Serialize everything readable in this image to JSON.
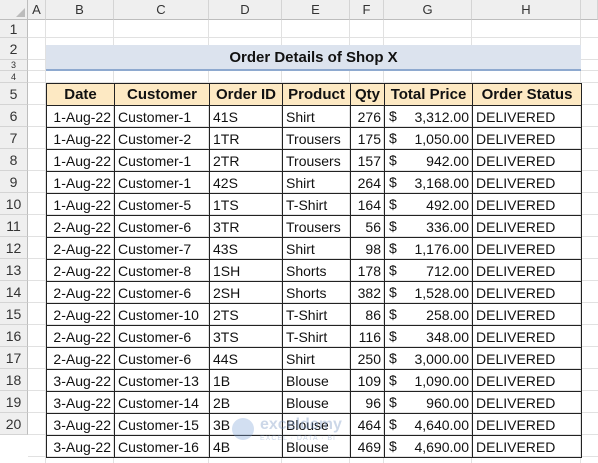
{
  "columns": [
    "A",
    "B",
    "C",
    "D",
    "E",
    "F",
    "G",
    "H"
  ],
  "rows": [
    "1",
    "2",
    "3",
    "4",
    "5",
    "6",
    "7",
    "8",
    "9",
    "10",
    "11",
    "12",
    "13",
    "14",
    "15",
    "16",
    "17",
    "18",
    "19",
    "20"
  ],
  "title": "Order Details of Shop X",
  "headers": [
    "Date",
    "Customer",
    "Order ID",
    "Product",
    "Qty",
    "Total Price",
    "Order Status"
  ],
  "currency_symbol": "$",
  "records": [
    [
      "1-Aug-22",
      "Customer-1",
      "41S",
      "Shirt",
      "276",
      "3,312.00",
      "DELIVERED"
    ],
    [
      "1-Aug-22",
      "Customer-2",
      "1TR",
      "Trousers",
      "175",
      "1,050.00",
      "DELIVERED"
    ],
    [
      "1-Aug-22",
      "Customer-1",
      "2TR",
      "Trousers",
      "157",
      "942.00",
      "DELIVERED"
    ],
    [
      "1-Aug-22",
      "Customer-1",
      "42S",
      "Shirt",
      "264",
      "3,168.00",
      "DELIVERED"
    ],
    [
      "1-Aug-22",
      "Customer-5",
      "1TS",
      "T-Shirt",
      "164",
      "492.00",
      "DELIVERED"
    ],
    [
      "2-Aug-22",
      "Customer-6",
      "3TR",
      "Trousers",
      "56",
      "336.00",
      "DELIVERED"
    ],
    [
      "2-Aug-22",
      "Customer-7",
      "43S",
      "Shirt",
      "98",
      "1,176.00",
      "DELIVERED"
    ],
    [
      "2-Aug-22",
      "Customer-8",
      "1SH",
      "Shorts",
      "178",
      "712.00",
      "DELIVERED"
    ],
    [
      "2-Aug-22",
      "Customer-6",
      "2SH",
      "Shorts",
      "382",
      "1,528.00",
      "DELIVERED"
    ],
    [
      "2-Aug-22",
      "Customer-10",
      "2TS",
      "T-Shirt",
      "86",
      "258.00",
      "DELIVERED"
    ],
    [
      "2-Aug-22",
      "Customer-6",
      "3TS",
      "T-Shirt",
      "116",
      "348.00",
      "DELIVERED"
    ],
    [
      "2-Aug-22",
      "Customer-6",
      "44S",
      "Shirt",
      "250",
      "3,000.00",
      "DELIVERED"
    ],
    [
      "3-Aug-22",
      "Customer-13",
      "1B",
      "Blouse",
      "109",
      "1,090.00",
      "DELIVERED"
    ],
    [
      "3-Aug-22",
      "Customer-14",
      "2B",
      "Blouse",
      "96",
      "960.00",
      "DELIVERED"
    ],
    [
      "3-Aug-22",
      "Customer-15",
      "3B",
      "Blouse",
      "464",
      "4,640.00",
      "DELIVERED"
    ],
    [
      "3-Aug-22",
      "Customer-16",
      "4B",
      "Blouse",
      "469",
      "4,690.00",
      "DELIVERED"
    ]
  ],
  "watermark": {
    "name": "exceldemy",
    "tagline": "EXCEL · DATA · BI"
  },
  "colors": {
    "title_fill": "#dce3ee",
    "title_border": "#8ea9cf",
    "header_fill": "#fde9c3"
  }
}
